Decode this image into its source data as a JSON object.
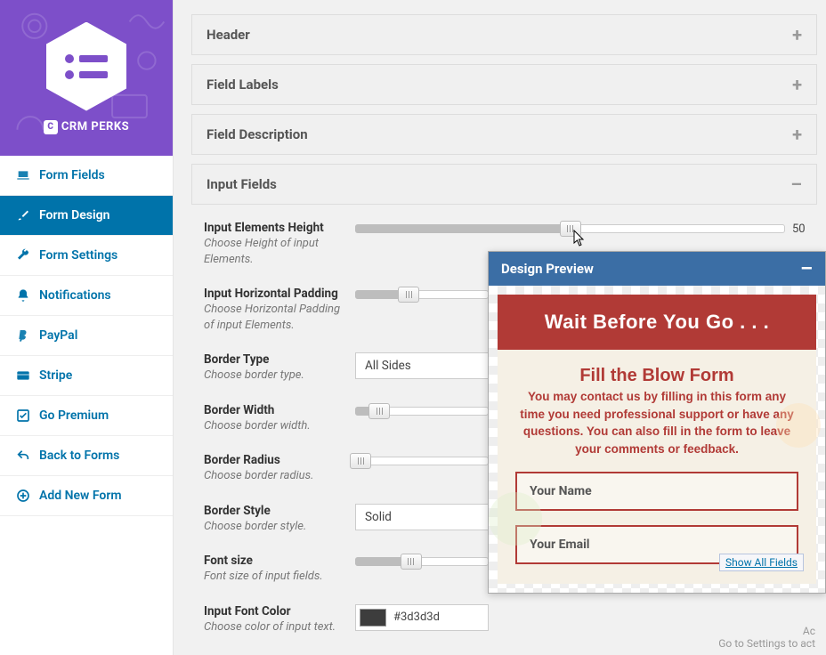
{
  "brand": {
    "name": "CRM PERKS"
  },
  "nav": [
    {
      "icon": "laptop",
      "label": "Form Fields"
    },
    {
      "icon": "brush",
      "label": "Form Design",
      "active": true
    },
    {
      "icon": "wrench",
      "label": "Form Settings"
    },
    {
      "icon": "bell",
      "label": "Notifications"
    },
    {
      "icon": "paypal",
      "label": "PayPal"
    },
    {
      "icon": "stripe",
      "label": "Stripe"
    },
    {
      "icon": "check-square",
      "label": "Go Premium"
    },
    {
      "icon": "back",
      "label": "Back to Forms"
    },
    {
      "icon": "plus-circle",
      "label": "Add New Form"
    }
  ],
  "accordions": {
    "header": "Header",
    "field_labels": "Field Labels",
    "field_description": "Field Description",
    "input_fields": "Input Fields"
  },
  "input_fields": {
    "height": {
      "label": "Input Elements Height",
      "desc": "Choose Height of input Elements.",
      "value": 50,
      "max": 100
    },
    "hpad": {
      "label": "Input Horizontal Padding",
      "desc": "Choose Horizontal Padding of input Elements.",
      "value": 12,
      "max": 100
    },
    "border_type": {
      "label": "Border Type",
      "desc": "Choose border type.",
      "value": "All Sides"
    },
    "border_width": {
      "label": "Border Width",
      "desc": "Choose border width.",
      "value": 8,
      "max": 100
    },
    "border_radius": {
      "label": "Border Radius",
      "desc": "Choose border radius.",
      "value": 2,
      "max": 100
    },
    "border_style": {
      "label": "Border Style",
      "desc": "Choose border style.",
      "value": "Solid"
    },
    "font_size": {
      "label": "Font size",
      "desc": "Font size of input fields.",
      "value": 14,
      "max": 100
    },
    "font_color": {
      "label": "Input Font Color",
      "desc": "Choose color of input text.",
      "value": "#3d3d3d"
    }
  },
  "preview": {
    "title": "Design Preview",
    "banner": "Wait Before You Go . . .",
    "fill_title": "Fill the Blow Form",
    "fill_desc": "You may contact us by filling in this form any time you need professional support or have any questions. You can also fill in the form to leave your comments or feedback.",
    "name_ph": "Your Name",
    "email_ph": "Your Email",
    "show_all": "Show All Fields"
  },
  "watermark": {
    "l1": "Ac",
    "l2": "Go to Settings to act"
  }
}
